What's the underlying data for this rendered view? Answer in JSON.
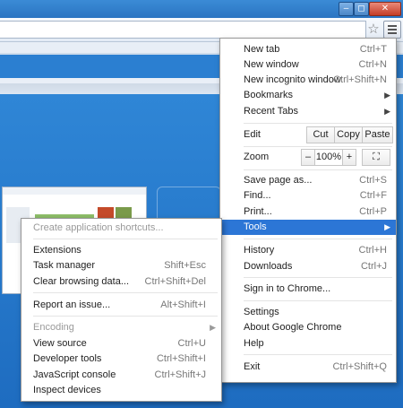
{
  "window": {
    "minimize_icon": "minimize-icon",
    "maximize_icon": "maximize-icon",
    "close_icon": "close-icon",
    "min_glyph": "–",
    "max_glyph": "◻",
    "close_glyph": "✕"
  },
  "toolbar": {
    "star_glyph": "☆"
  },
  "main_menu": {
    "items": [
      {
        "label": "New tab",
        "shortcut": "Ctrl+T"
      },
      {
        "label": "New window",
        "shortcut": "Ctrl+N"
      },
      {
        "label": "New incognito window",
        "shortcut": "Ctrl+Shift+N"
      },
      {
        "label": "Bookmarks",
        "submenu": true
      },
      {
        "label": "Recent Tabs",
        "submenu": true
      }
    ],
    "edit": {
      "label": "Edit",
      "cut": "Cut",
      "copy": "Copy",
      "paste": "Paste"
    },
    "zoom": {
      "label": "Zoom",
      "minus": "–",
      "value": "100%",
      "plus": "+",
      "fullscreen_icon": "fullscreen-icon"
    },
    "items2": [
      {
        "label": "Save page as...",
        "shortcut": "Ctrl+S"
      },
      {
        "label": "Find...",
        "shortcut": "Ctrl+F"
      },
      {
        "label": "Print...",
        "shortcut": "Ctrl+P"
      },
      {
        "label": "Tools",
        "submenu": true,
        "highlighted": true
      },
      {
        "label": "History",
        "shortcut": "Ctrl+H"
      },
      {
        "label": "Downloads",
        "shortcut": "Ctrl+J"
      },
      {
        "label": "Sign in to Chrome..."
      },
      {
        "label": "Settings"
      },
      {
        "label": "About Google Chrome"
      },
      {
        "label": "Help"
      },
      {
        "label": "Exit",
        "shortcut": "Ctrl+Shift+Q"
      }
    ]
  },
  "tools_menu": {
    "items": [
      {
        "label": "Create application shortcuts...",
        "disabled": true
      },
      {
        "label": "Extensions"
      },
      {
        "label": "Task manager",
        "shortcut": "Shift+Esc"
      },
      {
        "label": "Clear browsing data...",
        "shortcut": "Ctrl+Shift+Del"
      },
      {
        "label": "Report an issue...",
        "shortcut": "Alt+Shift+I"
      },
      {
        "label": "Encoding",
        "disabled": true,
        "submenu": true
      },
      {
        "label": "View source",
        "shortcut": "Ctrl+U"
      },
      {
        "label": "Developer tools",
        "shortcut": "Ctrl+Shift+I"
      },
      {
        "label": "JavaScript console",
        "shortcut": "Ctrl+Shift+J"
      },
      {
        "label": "Inspect devices"
      }
    ]
  },
  "colors": {
    "highlight": "#2c76d6",
    "desktop": "#1f6fb8"
  }
}
